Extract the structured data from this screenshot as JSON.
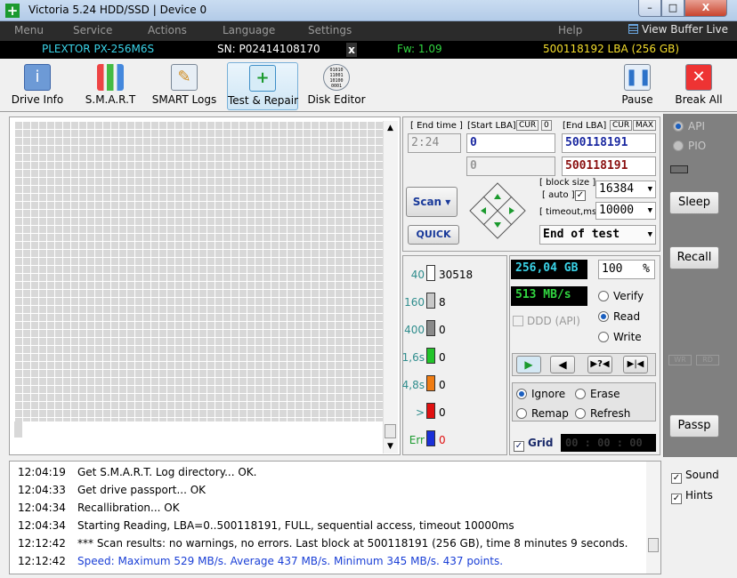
{
  "window": {
    "title": "Victoria 5.24 HDD/SSD | Device 0",
    "min": "–",
    "max": "□",
    "close": "X"
  },
  "menu": {
    "items": [
      "Menu",
      "Service",
      "Actions",
      "Language",
      "Settings",
      "Help"
    ],
    "view_buffer": "View Buffer Live"
  },
  "device": {
    "model": "PLEXTOR PX-256M6S",
    "sn": "SN: P02414108170",
    "x": "x",
    "fw": "Fw: 1.09",
    "lba": "500118192 LBA (256 GB)"
  },
  "toolbar": {
    "drive_info": "Drive Info",
    "smart": "S.M.A.R.T",
    "smart_logs": "SMART Logs",
    "test_repair": "Test & Repair",
    "disk_editor": "Disk Editor",
    "pause": "Pause",
    "break_all": "Break All",
    "disk_editor_icon_text": "01010\n11001\n10100\n0001"
  },
  "scan": {
    "end_time_label": "[ End time ]",
    "end_time": "2:24",
    "start_lba_label": "[Start LBA]",
    "cur": "CUR",
    "zero": "0",
    "start_lba": "0",
    "start_lba2": "0",
    "end_lba_label": "[End LBA]",
    "max": "MAX",
    "end_lba": "500118191",
    "end_lba2": "500118191",
    "block_size_label": "[ block size ]",
    "auto_label": "[ auto ]",
    "block_size": "16384",
    "timeout_label": "[ timeout,ms ]",
    "timeout": "10000",
    "scan_button": "Scan",
    "quick_button": "QUICK",
    "end_of_test": "End of test"
  },
  "buckets": [
    {
      "label": "40",
      "count": "30518",
      "color": "#ffffff"
    },
    {
      "label": "160",
      "count": "8",
      "color": "#c8c8c8"
    },
    {
      "label": "400",
      "count": "0",
      "color": "#8a8a8a"
    },
    {
      "label": "1,6s",
      "count": "0",
      "color": "#22c42a"
    },
    {
      "label": "4,8s",
      "count": "0",
      "color": "#f07c12"
    },
    {
      "label": ">",
      "count": "0",
      "color": "#e01010"
    },
    {
      "label": "Err",
      "count": "0",
      "color": "#1a30d8"
    }
  ],
  "progress": {
    "size": "256,04 GB",
    "percent": "100",
    "percent_sign": "%",
    "speed": "513 MB/s",
    "ddd": "DDD (API)"
  },
  "mode": {
    "verify": "Verify",
    "read": "Read",
    "write": "Write"
  },
  "action": {
    "ignore": "Ignore",
    "erase": "Erase",
    "remap": "Remap",
    "refresh": "Refresh"
  },
  "grid": {
    "label": "Grid",
    "timer": "00 : 00 : 00"
  },
  "side": {
    "api": "API",
    "pio": "PIO",
    "sleep": "Sleep",
    "recall": "Recall",
    "passp": "Passp",
    "wr": "WR",
    "rd": "RD"
  },
  "log": [
    {
      "time": "12:04:19",
      "text": "Get S.M.A.R.T. Log directory... OK.",
      "color": "#000000"
    },
    {
      "time": "12:04:33",
      "text": "Get drive passport... OK",
      "color": "#000000"
    },
    {
      "time": "12:04:34",
      "text": "Recallibration... OK",
      "color": "#000000"
    },
    {
      "time": "12:04:34",
      "text": "Starting Reading, LBA=0..500118191, FULL, sequential access, timeout 10000ms",
      "color": "#000000"
    },
    {
      "time": "12:12:42",
      "text": "*** Scan results: no warnings, no errors. Last block at 500118191 (256 GB), time 8 minutes 9 seconds.",
      "color": "#000000"
    },
    {
      "time": "12:12:42",
      "text": "Speed: Maximum 529 MB/s. Average 437 MB/s. Minimum 345 MB/s. 437 points.",
      "color": "#1a3fd6"
    }
  ],
  "options": {
    "sound": "Sound",
    "hints": "Hints"
  }
}
